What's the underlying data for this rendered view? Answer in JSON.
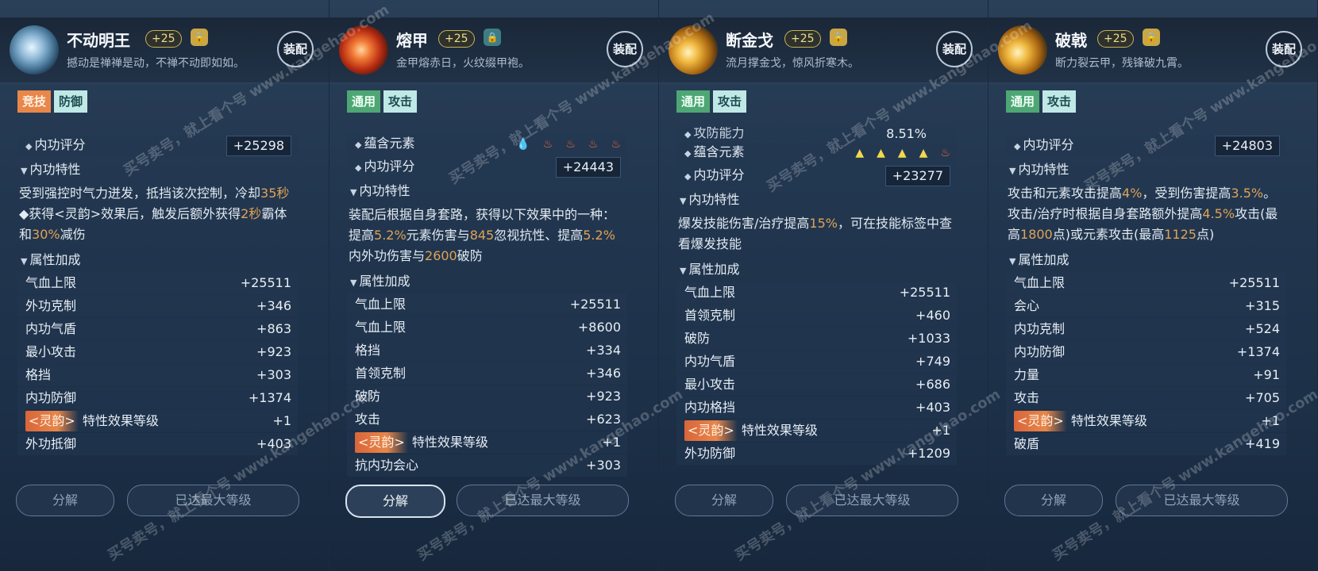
{
  "panels": [
    {
      "name": "不动明王",
      "level": "+25",
      "desc": "撼动是禅禅是动，不禅不动即如如。",
      "equip": "装配",
      "tags": [
        "竞技",
        "防御"
      ],
      "score_label": "内功评分",
      "score": "+25298",
      "trait_label": "内功特性",
      "trait_text": {
        "p1": "受到强控时气力迸发，抵挡该次控制，冷却",
        "h1": "35秒",
        "p2": "◆获得<灵韵>效果后，触发后额外获得",
        "h2": "2秒",
        "p3": "霸体和",
        "h3": "30%",
        "p4": "减伤"
      },
      "attr_label": "属性加成",
      "attrs": [
        {
          "name": "气血上限",
          "value": "+25511"
        },
        {
          "name": "外功克制",
          "value": "+346"
        },
        {
          "name": "内功气盾",
          "value": "+863"
        },
        {
          "name": "最小攻击",
          "value": "+923"
        },
        {
          "name": "格挡",
          "value": "+303"
        },
        {
          "name": "内功防御",
          "value": "+1374"
        }
      ],
      "lingyun": {
        "tag": "<灵韵>",
        "name": "特性效果等级",
        "value": "+1"
      },
      "last_attr": {
        "name": "外功抵御",
        "value": "+403"
      },
      "decompose": "分解",
      "max_level": "已达最大等级"
    },
    {
      "name": "熔甲",
      "level": "+25",
      "desc": "金甲熔赤日，火纹缀甲袍。",
      "equip": "装配",
      "tags": [
        "通用",
        "攻击"
      ],
      "element_label": "蕴含元素",
      "score_label": "内功评分",
      "score": "+24443",
      "trait_label": "内功特性",
      "trait_text": {
        "p1": "装配后根据自身套路，获得以下效果中的一种：提高",
        "h1": "5.2%",
        "p2": "元素伤害与",
        "h2": "845",
        "p3": "忽视抗性、提高",
        "h3": "5.2%",
        "p4": "内外功伤害与",
        "h4": "2600",
        "p5": "破防"
      },
      "attr_label": "属性加成",
      "attrs": [
        {
          "name": "气血上限",
          "value": "+25511"
        },
        {
          "name": "气血上限",
          "value": "+8600"
        },
        {
          "name": "格挡",
          "value": "+334"
        },
        {
          "name": "首领克制",
          "value": "+346"
        },
        {
          "name": "破防",
          "value": "+923"
        },
        {
          "name": "攻击",
          "value": "+623"
        }
      ],
      "lingyun": {
        "tag": "<灵韵>",
        "name": "特性效果等级",
        "value": "+1"
      },
      "last_attr": {
        "name": "抗内功会心",
        "value": "+303"
      },
      "decompose": "分解",
      "max_level": "已达最大等级"
    },
    {
      "name": "断金戈",
      "level": "+25",
      "desc": "流月撑金戈，惊风折寒木。",
      "equip": "装配",
      "tags": [
        "通用",
        "攻击"
      ],
      "partial_label": "攻防能力",
      "partial_value": "8.51%",
      "element_label": "蕴含元素",
      "score_label": "内功评分",
      "score": "+23277",
      "trait_label": "内功特性",
      "trait_text": {
        "p1": "爆发技能伤害/治疗提高",
        "h1": "15%",
        "p2": "，可在技能标签中查看爆发技能"
      },
      "attr_label": "属性加成",
      "attrs": [
        {
          "name": "气血上限",
          "value": "+25511"
        },
        {
          "name": "首领克制",
          "value": "+460"
        },
        {
          "name": "破防",
          "value": "+1033"
        },
        {
          "name": "内功气盾",
          "value": "+749"
        },
        {
          "name": "最小攻击",
          "value": "+686"
        },
        {
          "name": "内功格挡",
          "value": "+403"
        }
      ],
      "lingyun": {
        "tag": "<灵韵>",
        "name": "特性效果等级",
        "value": "+1"
      },
      "last_attr": {
        "name": "外功防御",
        "value": "+1209"
      },
      "decompose": "分解",
      "max_level": "已达最大等级"
    },
    {
      "name": "破戟",
      "level": "+25",
      "desc": "断力裂云甲，残锋破九霄。",
      "equip": "装配",
      "tags": [
        "通用",
        "攻击"
      ],
      "score_label": "内功评分",
      "score": "+24803",
      "trait_label": "内功特性",
      "trait_text": {
        "p1": "攻击和元素攻击提高",
        "h1": "4%",
        "p2": "，受到伤害提高",
        "h2": "3.5%",
        "p3": "。攻击/治疗时根据自身套路额外提高",
        "h3": "4.5%",
        "p4": "攻击(最高",
        "h4": "1800",
        "p5": "点)或元素攻击(最高",
        "h5": "1125",
        "p6": "点)"
      },
      "attr_label": "属性加成",
      "attrs": [
        {
          "name": "气血上限",
          "value": "+25511"
        },
        {
          "name": "会心",
          "value": "+315"
        },
        {
          "name": "内功克制",
          "value": "+524"
        },
        {
          "name": "内功防御",
          "value": "+1374"
        },
        {
          "name": "力量",
          "value": "+91"
        },
        {
          "name": "攻击",
          "value": "+705"
        }
      ],
      "lingyun": {
        "tag": "<灵韵>",
        "name": "特性效果等级",
        "value": "+1"
      },
      "last_attr": {
        "name": "破盾",
        "value": "+419"
      },
      "decompose": "分解",
      "max_level": "已达最大等级"
    }
  ],
  "icons": {
    "element_water": "water-drop-icon",
    "element_fire": "fire-icon",
    "element_thunder": "thunder-icon",
    "lock": "lock-icon"
  },
  "colors": {
    "highlight": "#e0a257",
    "tag_orange": "#e8874a",
    "tag_green": "#4ea674",
    "tag_teal": "#bfe8e6"
  },
  "watermark": "买号卖号，就上看个号 www.kangehao.com"
}
